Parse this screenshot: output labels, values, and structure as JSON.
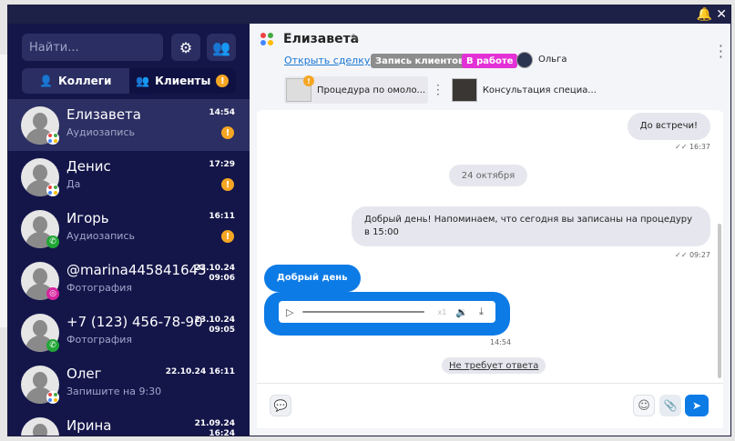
{
  "window": {
    "bell_icon": "bell-icon",
    "close_icon": "close-icon"
  },
  "sidebar": {
    "search_placeholder": "Найти...",
    "tabs": [
      {
        "label": "Коллеги",
        "icon": "user-icon"
      },
      {
        "label": "Клиенты",
        "icon": "users-icon",
        "badge": "!"
      }
    ],
    "conversations": [
      {
        "name": "Елизавета",
        "subtitle": "Аудиозапись",
        "time": "14:54",
        "channel": "multi",
        "badge": "!",
        "active": true
      },
      {
        "name": "Денис",
        "subtitle": "Да",
        "time": "17:29",
        "channel": "multi",
        "badge": "!"
      },
      {
        "name": "Игорь",
        "subtitle": "Аудиозапись",
        "time": "16:11",
        "channel": "phone",
        "badge": "!"
      },
      {
        "name": "@marina445841645",
        "subtitle": "Фотография",
        "time": "23.10.24\n09:06",
        "channel": "instagram"
      },
      {
        "name": "+7 (123) 456-78-90",
        "subtitle": "Фотография",
        "time": "23.10.24\n09:05",
        "channel": "phone"
      },
      {
        "name": "Олег",
        "subtitle": "Запишите на 9:30",
        "time": "22.10.24 16:11",
        "channel": "multi"
      },
      {
        "name": "Ирина",
        "subtitle": "",
        "time": "21.09.24\n16:24",
        "channel": "multi"
      }
    ]
  },
  "header": {
    "title": "Елизавета",
    "open_deal": "Открыть сделку",
    "tag_gray": "Запись клиентов",
    "tag_pink": "В работе",
    "operator": "Ольга",
    "deals": [
      "Процедура по омоло...",
      "Консультация специа..."
    ]
  },
  "messages": {
    "m1_text": "До встречи!",
    "m1_time": "16:37",
    "date_sep": "24 октября",
    "m2_text": "Добрый день! Напоминаем, что сегодня вы записаны на процедуру в 15:00",
    "m2_time": "09:27",
    "m3_text": "Добрый день",
    "audio_speed": "x1",
    "audio_time": "14:54",
    "no_reply": "Не требует ответа"
  },
  "composer": {
    "placeholder": ""
  },
  "colors": {
    "sidebar_bg": "#14164a",
    "accent": "#0d7be6",
    "warning": "#f5a623",
    "pink_tag": "#e331d6"
  }
}
